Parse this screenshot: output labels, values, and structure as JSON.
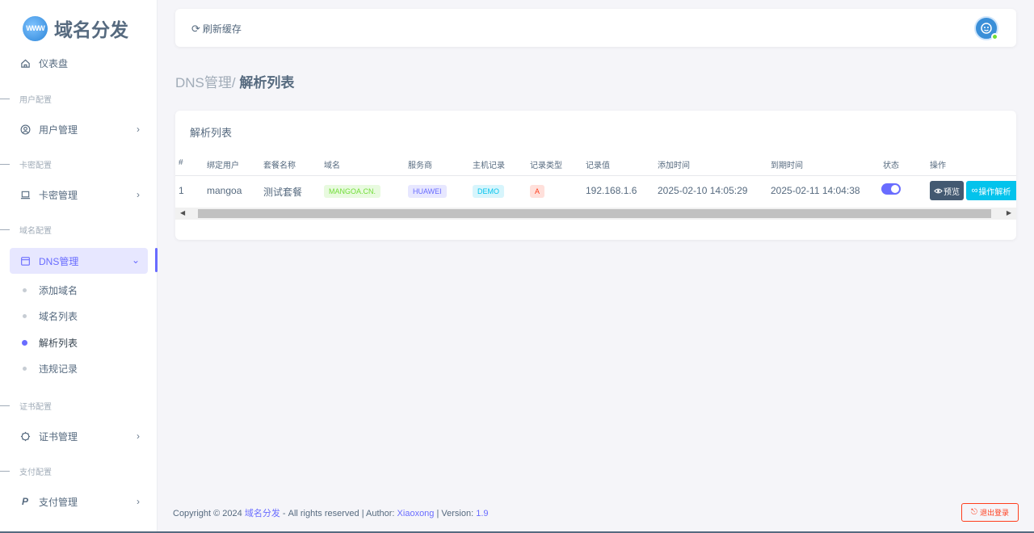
{
  "brand": {
    "name": "域名分发"
  },
  "sidebar": {
    "dashboard": "仪表盘",
    "sections": [
      "用户配置",
      "卡密配置",
      "域名配置",
      "证书配置",
      "支付配置"
    ],
    "items": {
      "users": "用户管理",
      "cards": "卡密管理",
      "dns": "DNS管理",
      "certs": "证书管理",
      "pay": "支付管理"
    },
    "dns_sub": [
      "添加域名",
      "域名列表",
      "解析列表",
      "违规记录"
    ]
  },
  "navbar": {
    "refresh": "刷新缓存"
  },
  "breadcrumb": {
    "parent": "DNS管理/",
    "current": "解析列表"
  },
  "table": {
    "title": "解析列表",
    "headers": [
      "#",
      "绑定用户",
      "套餐名称",
      "域名",
      "服务商",
      "主机记录",
      "记录类型",
      "记录值",
      "添加时间",
      "到期时间",
      "状态",
      "操作"
    ],
    "row": {
      "id": "1",
      "user": "mangoa",
      "package": "测试套餐",
      "domain": "MANGOA.CN.",
      "provider": "HUAWEI",
      "host": "DEMO",
      "type": "A",
      "value": "192.168.1.6",
      "added": "2025-02-10 14:05:29",
      "expires": "2025-02-11 14:04:38",
      "enabled": true,
      "btn_preview": "预览",
      "btn_op": "操作解析"
    }
  },
  "footer": {
    "copy": "Copyright © 2024",
    "site": "域名分发",
    "rights": "- All rights reserved | Author:",
    "author": "Xiaoxong",
    "version_label": "| Version:",
    "version": "1.9",
    "logout": "退出登录"
  },
  "colors": {
    "accent": "#696cff",
    "text": "#566a7f",
    "danger": "#ff3e1d",
    "info": "#03c3ec"
  }
}
